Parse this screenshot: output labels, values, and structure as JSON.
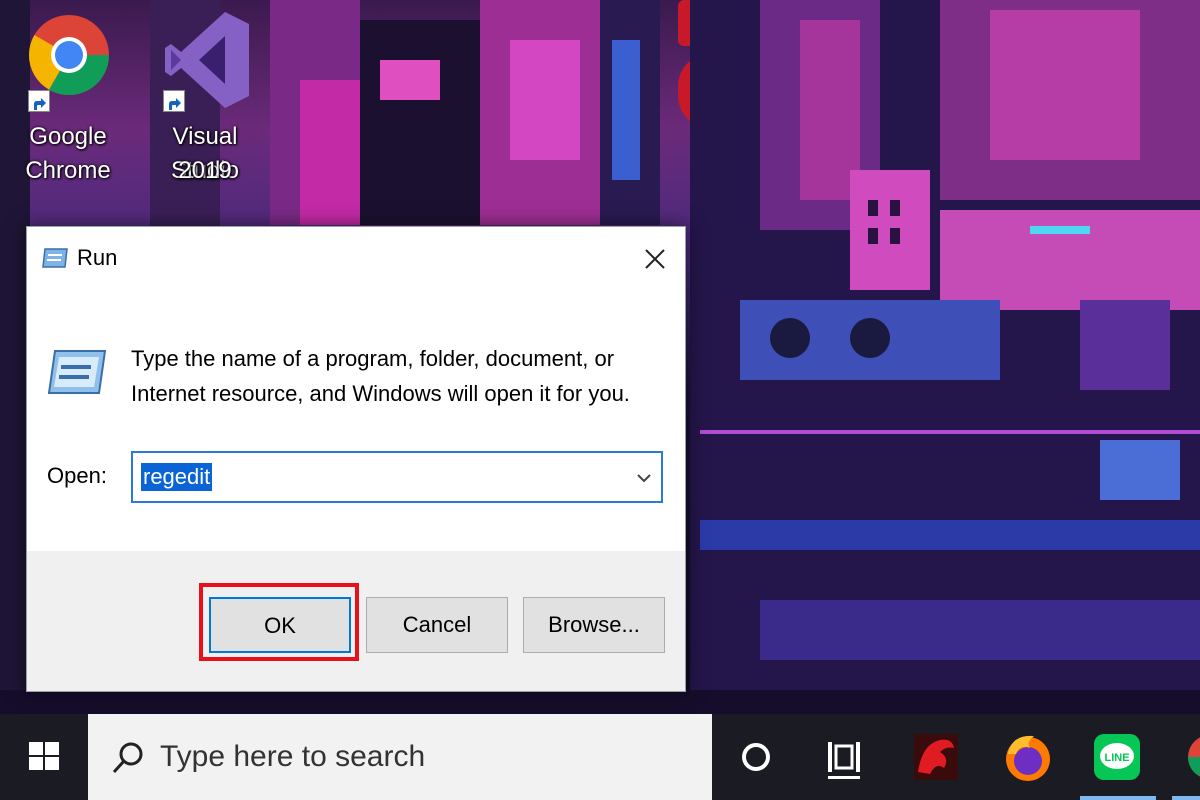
{
  "desktop": {
    "icons": [
      {
        "label_line1": "Google",
        "label_line2": "Chrome",
        "icon": "chrome-icon"
      },
      {
        "label_line1": "Visual Studio",
        "label_line2": "2019",
        "icon": "visual-studio-icon"
      }
    ]
  },
  "run_dialog": {
    "title": "Run",
    "description": "Type the name of a program, folder, document, or Internet resource, and Windows will open it for you.",
    "open_label": "Open:",
    "open_value": "regedit",
    "buttons": {
      "ok": "OK",
      "cancel": "Cancel",
      "browse": "Browse..."
    },
    "highlight_color": "#e8101a"
  },
  "taskbar": {
    "search_placeholder": "Type here to search",
    "pinned": [
      "cortana-icon",
      "task-view-icon",
      "msi-dragon-icon",
      "firefox-icon",
      "line-icon",
      "chrome-icon"
    ]
  },
  "colors": {
    "accent": "#0078d7",
    "selection": "#0a64d6",
    "taskbar": "#1b1b24"
  }
}
